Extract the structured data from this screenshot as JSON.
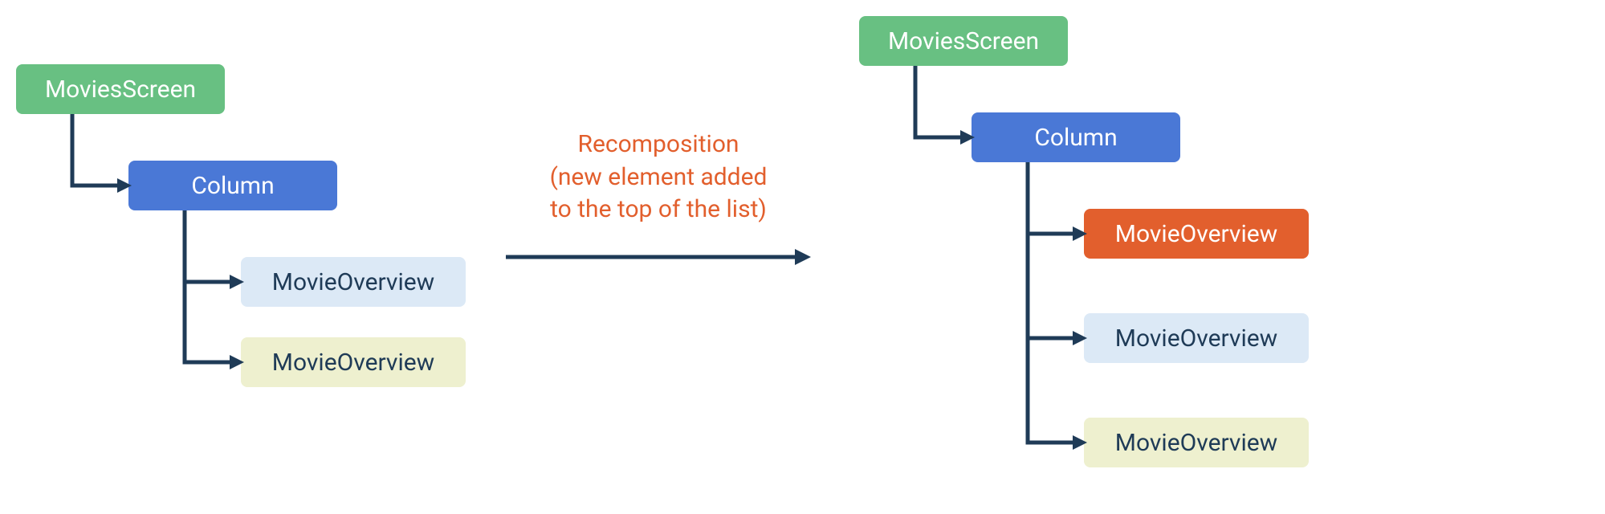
{
  "left_tree": {
    "root": {
      "label": "MoviesScreen"
    },
    "column": {
      "label": "Column"
    },
    "items": [
      {
        "label": "MovieOverview",
        "color": "lightblue"
      },
      {
        "label": "MovieOverview",
        "color": "yellow"
      }
    ]
  },
  "center": {
    "line1": "Recomposition",
    "line2": "(new element added",
    "line3": "to the top of the list)"
  },
  "right_tree": {
    "root": {
      "label": "MoviesScreen"
    },
    "column": {
      "label": "Column"
    },
    "items": [
      {
        "label": "MovieOverview",
        "color": "orange"
      },
      {
        "label": "MovieOverview",
        "color": "lightblue"
      },
      {
        "label": "MovieOverview",
        "color": "yellow"
      }
    ]
  },
  "colors": {
    "green": "#68c082",
    "blue": "#4a78d6",
    "lightblue": "#dce9f6",
    "yellow": "#eef0cf",
    "orange": "#e25f2d",
    "text_dark": "#1f3b57"
  }
}
